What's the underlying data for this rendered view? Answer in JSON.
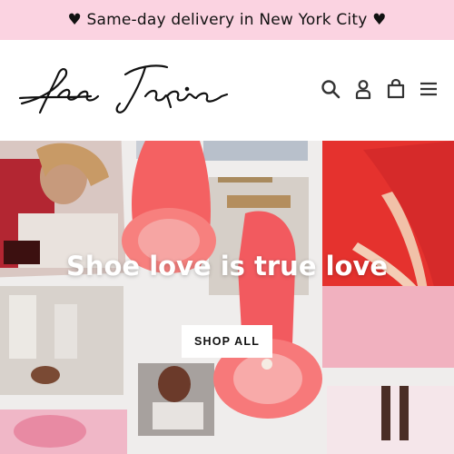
{
  "announcement": {
    "text": "♥ Same-day delivery in New York City ♥",
    "background": "#fbd3e1"
  },
  "header": {
    "logo_text": "Isa Tapia",
    "icons": [
      "search-icon",
      "account-icon",
      "cart-icon",
      "menu-icon"
    ]
  },
  "hero": {
    "title": "Shoe love is true love",
    "button_label": "SHOP ALL"
  },
  "colors": {
    "accent_pink": "#fbd3e1",
    "shoe_coral": "#f2595c",
    "text": "#111111"
  }
}
